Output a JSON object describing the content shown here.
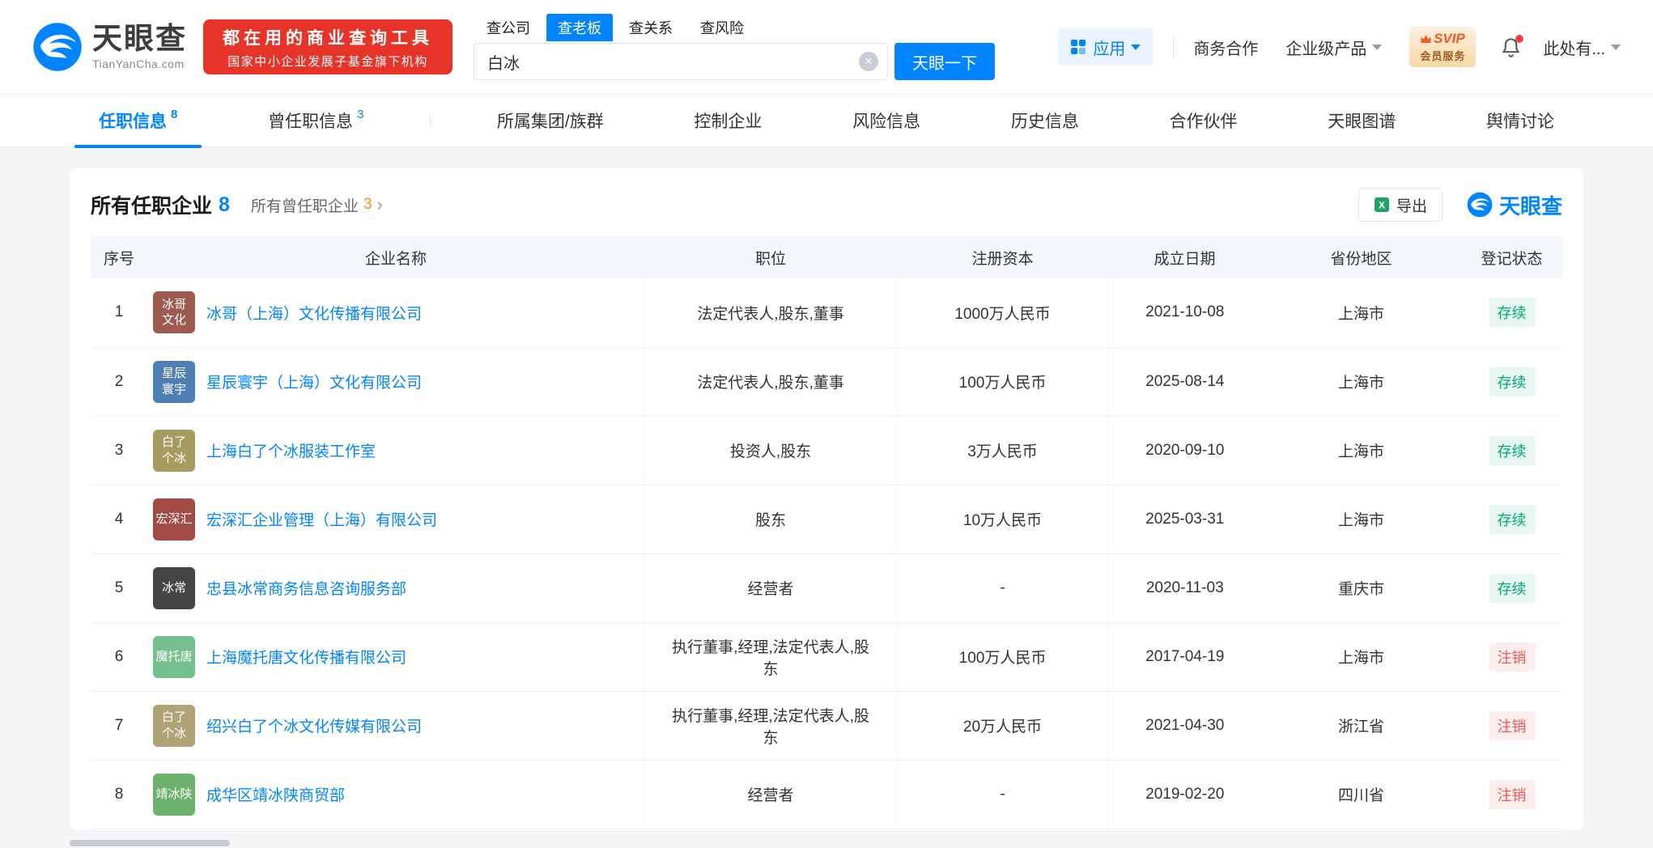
{
  "brand": {
    "name": "天眼查",
    "domain": "TianYanCha.com",
    "color": "#0084ff"
  },
  "promo": {
    "line1": "都在用的商业查询工具",
    "line2": "国家中小企业发展子基金旗下机构",
    "bg": "#e73328"
  },
  "search": {
    "tabs": [
      {
        "label": "查公司"
      },
      {
        "label": "查老板"
      },
      {
        "label": "查关系"
      },
      {
        "label": "查风险"
      }
    ],
    "active_tab": "查老板",
    "value": "白冰",
    "button": "天眼一下"
  },
  "nav": {
    "apps_label": "应用",
    "biz": "商务合作",
    "enterprise": "企业级产品",
    "svip_line1": "SVIP",
    "svip_line2": "会员服务",
    "user": "此处有..."
  },
  "section_tabs": [
    {
      "label": "任职信息",
      "count": "8"
    },
    {
      "label": "曾任职信息",
      "count": "3"
    },
    {
      "label": "所属集团/族群"
    },
    {
      "label": "控制企业"
    },
    {
      "label": "风险信息"
    },
    {
      "label": "历史信息"
    },
    {
      "label": "合作伙伴"
    },
    {
      "label": "天眼图谱"
    },
    {
      "label": "舆情讨论"
    }
  ],
  "card": {
    "title": "所有任职企业",
    "title_count": "8",
    "link": "所有曾任职企业",
    "link_count": "3",
    "link_arrow": "›",
    "export": "导出",
    "watermark": "天眼查"
  },
  "table": {
    "columns": [
      "序号",
      "企业名称",
      "职位",
      "注册资本",
      "成立日期",
      "省份地区",
      "登记状态"
    ],
    "rows": [
      {
        "no": "1",
        "avatar_text": "冰哥\n文化",
        "avatar_color": "#9e5a4e",
        "company": "冰哥（上海）文化传播有限公司",
        "position": "法定代表人,股东,董事",
        "capital": "1000万人民币",
        "date": "2021-10-08",
        "region": "上海市",
        "status": "存续",
        "status_color": "#00a870",
        "status_bg": "#e8f7ef"
      },
      {
        "no": "2",
        "avatar_text": "星辰\n寰宇",
        "avatar_color": "#4e7fb7",
        "company": "星辰寰宇（上海）文化有限公司",
        "position": "法定代表人,股东,董事",
        "capital": "100万人民币",
        "date": "2025-08-14",
        "region": "上海市",
        "status": "存续",
        "status_color": "#00a870",
        "status_bg": "#e8f7ef"
      },
      {
        "no": "3",
        "avatar_text": "白了\n个冰",
        "avatar_color": "#a79b5f",
        "company": "上海白了个冰服装工作室",
        "position": "投资人,股东",
        "capital": "3万人民币",
        "date": "2020-09-10",
        "region": "上海市",
        "status": "存续",
        "status_color": "#00a870",
        "status_bg": "#e8f7ef"
      },
      {
        "no": "4",
        "avatar_text": "宏深汇",
        "avatar_color": "#a34a44",
        "company": "宏深汇企业管理（上海）有限公司",
        "position": "股东",
        "capital": "10万人民币",
        "date": "2025-03-31",
        "region": "上海市",
        "status": "存续",
        "status_color": "#00a870",
        "status_bg": "#e8f7ef"
      },
      {
        "no": "5",
        "avatar_text": "冰常",
        "avatar_color": "#454545",
        "company": "忠县冰常商务信息咨询服务部",
        "position": "经营者",
        "capital": "-",
        "date": "2020-11-03",
        "region": "重庆市",
        "status": "存续",
        "status_color": "#00a870",
        "status_bg": "#e8f7ef"
      },
      {
        "no": "6",
        "avatar_text": "魔托唐",
        "avatar_color": "#76c08f",
        "company": "上海魔托唐文化传播有限公司",
        "position": "执行董事,经理,法定代表人,股东",
        "capital": "100万人民币",
        "date": "2017-04-19",
        "region": "上海市",
        "status": "注销",
        "status_color": "#f25757",
        "status_bg": "#fdeeee"
      },
      {
        "no": "7",
        "avatar_text": "白了\n个冰",
        "avatar_color": "#b0a476",
        "company": "绍兴白了个冰文化传媒有限公司",
        "position": "执行董事,经理,法定代表人,股东",
        "capital": "20万人民币",
        "date": "2021-04-30",
        "region": "浙江省",
        "status": "注销",
        "status_color": "#f25757",
        "status_bg": "#fdeeee"
      },
      {
        "no": "8",
        "avatar_text": "靖冰陕",
        "avatar_color": "#6cb26c",
        "company": "成华区靖冰陕商贸部",
        "position": "经营者",
        "capital": "-",
        "date": "2019-02-20",
        "region": "四川省",
        "status": "注销",
        "status_color": "#f25757",
        "status_bg": "#fdeeee"
      }
    ]
  }
}
